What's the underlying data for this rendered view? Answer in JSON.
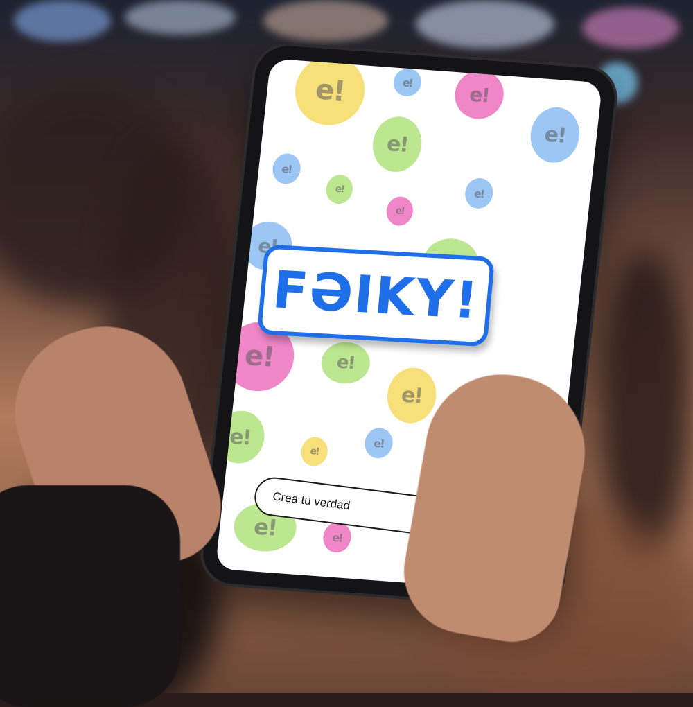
{
  "app": {
    "logo_text": "FƏIKY!",
    "bubble_glyph": "e!",
    "cta_label": "Crea tu verdad",
    "cta_arrow": "→"
  },
  "colors": {
    "brand_blue": "#1f6fe8",
    "bubble_yellow": "#f7e07a",
    "bubble_pink": "#ef86c8",
    "bubble_green": "#bde690",
    "bubble_blue": "#9cc7f5"
  }
}
